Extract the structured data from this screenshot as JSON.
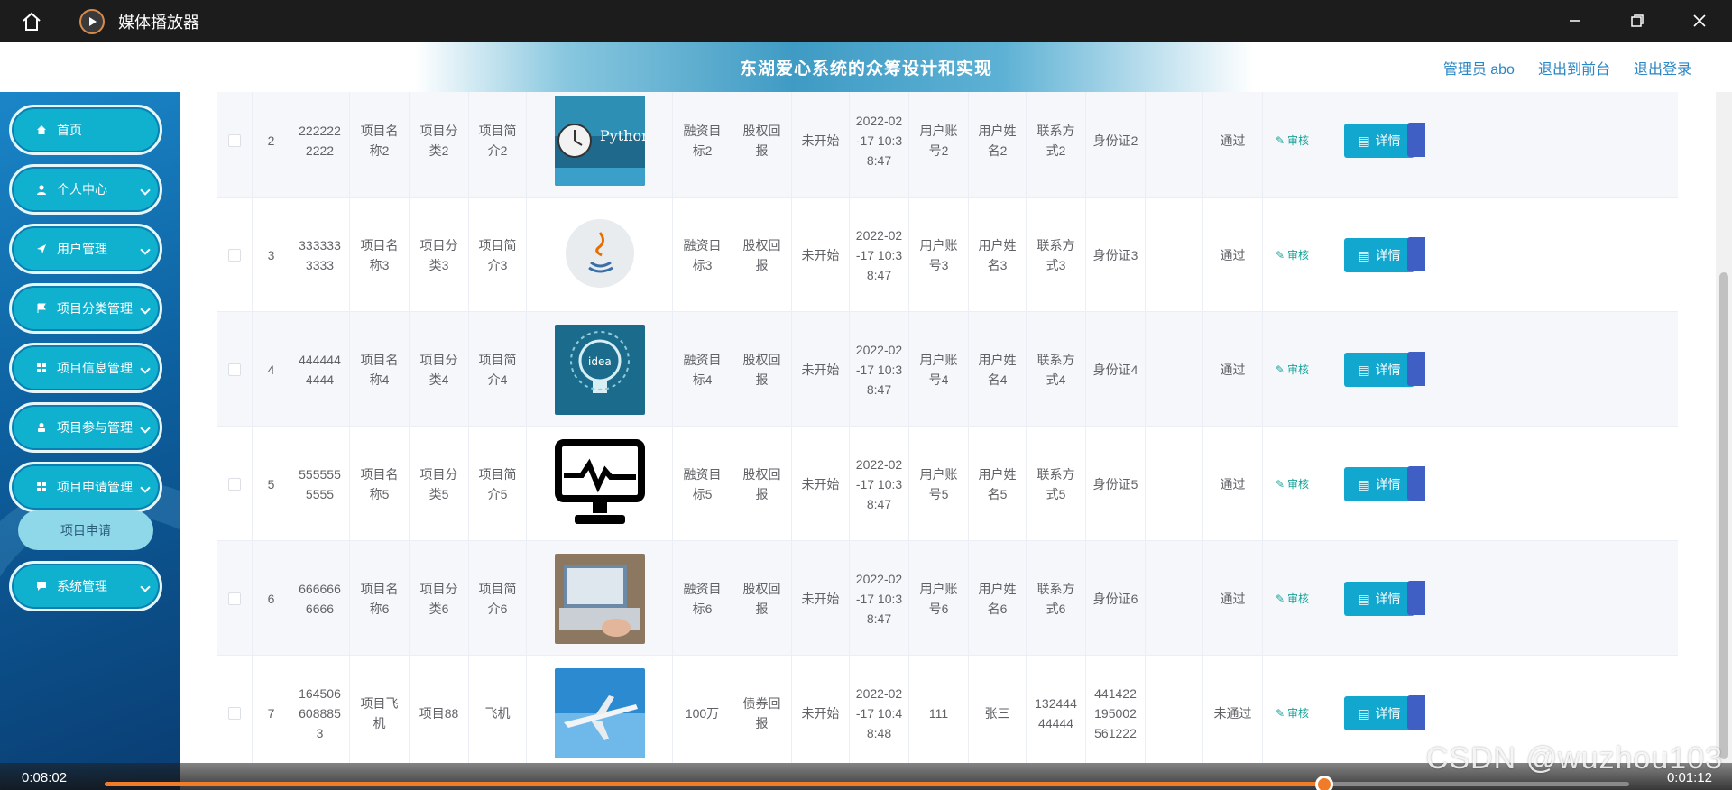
{
  "titlebar": {
    "title": "媒体播放器",
    "icons": [
      "home-icon",
      "media-player-logo-icon",
      "minimize-icon",
      "restore-icon",
      "close-icon"
    ]
  },
  "header": {
    "title": "东湖爱心系统的众筹设计和实现",
    "links": [
      "管理员 abo",
      "退出到前台",
      "退出登录"
    ]
  },
  "sidebar": {
    "items": [
      {
        "label": "首页",
        "icon": "home-icon",
        "expandable": false
      },
      {
        "label": "个人中心",
        "icon": "user-icon",
        "expandable": true
      },
      {
        "label": "用户管理",
        "icon": "send-icon",
        "expandable": true
      },
      {
        "label": "项目分类管理",
        "icon": "flag-icon",
        "expandable": true
      },
      {
        "label": "项目信息管理",
        "icon": "grid-icon",
        "expandable": true
      },
      {
        "label": "项目参与管理",
        "icon": "person-icon",
        "expandable": true
      },
      {
        "label": "项目申请管理",
        "icon": "grid-icon",
        "expandable": true
      },
      {
        "label": "系统管理",
        "icon": "chat-icon",
        "expandable": true
      }
    ],
    "submenu": {
      "label": "项目申请",
      "after": 6
    }
  },
  "table": {
    "rows": [
      {
        "idx": "2",
        "code": "2222222222",
        "name": "项目名称2",
        "cat": "项目分类2",
        "intro": "项目简介2",
        "image": "python",
        "target": "融资目标2",
        "reward": "股权回报",
        "status": "未开始",
        "time": "2022-02-17 10:38:47",
        "account": "用户账号2",
        "username": "用户姓名2",
        "contact": "联系方式2",
        "idcard": "身份证2",
        "review": "通过"
      },
      {
        "idx": "3",
        "code": "3333333333",
        "name": "项目名称3",
        "cat": "项目分类3",
        "intro": "项目简介3",
        "image": "java",
        "target": "融资目标3",
        "reward": "股权回报",
        "status": "未开始",
        "time": "2022-02-17 10:38:47",
        "account": "用户账号3",
        "username": "用户姓名3",
        "contact": "联系方式3",
        "idcard": "身份证3",
        "review": "通过"
      },
      {
        "idx": "4",
        "code": "4444444444",
        "name": "项目名称4",
        "cat": "项目分类4",
        "intro": "项目简介4",
        "image": "idea",
        "target": "融资目标4",
        "reward": "股权回报",
        "status": "未开始",
        "time": "2022-02-17 10:38:47",
        "account": "用户账号4",
        "username": "用户姓名4",
        "contact": "联系方式4",
        "idcard": "身份证4",
        "review": "通过"
      },
      {
        "idx": "5",
        "code": "5555555555",
        "name": "项目名称5",
        "cat": "项目分类5",
        "intro": "项目简介5",
        "image": "monitor",
        "target": "融资目标5",
        "reward": "股权回报",
        "status": "未开始",
        "time": "2022-02-17 10:38:47",
        "account": "用户账号5",
        "username": "用户姓名5",
        "contact": "联系方式5",
        "idcard": "身份证5",
        "review": "通过"
      },
      {
        "idx": "6",
        "code": "6666666666",
        "name": "项目名称6",
        "cat": "项目分类6",
        "intro": "项目简介6",
        "image": "laptop",
        "target": "融资目标6",
        "reward": "股权回报",
        "status": "未开始",
        "time": "2022-02-17 10:38:47",
        "account": "用户账号6",
        "username": "用户姓名6",
        "contact": "联系方式6",
        "idcard": "身份证6",
        "review": "通过"
      },
      {
        "idx": "7",
        "code": "1645066088853",
        "name": "项目飞机",
        "cat": "项目88",
        "intro": "飞机",
        "image": "airplane",
        "target": "100万",
        "reward": "债券回报",
        "status": "未开始",
        "time": "2022-02-17 10:48:48",
        "account": "111",
        "username": "张三",
        "contact": "13244444444",
        "idcard": "441422195002561222",
        "review": "未通过"
      }
    ],
    "audit_label": "审核",
    "detail_label": "详情"
  },
  "media": {
    "elapsed": "0:08:02",
    "remaining": "0:01:12",
    "progress": 0.8
  },
  "watermark": "CSDN @wuzhou103",
  "colors": {
    "accent": "#11a7cf",
    "progress": "#f07c2a",
    "link": "#2a86c4",
    "audit": "#1aa59a"
  }
}
